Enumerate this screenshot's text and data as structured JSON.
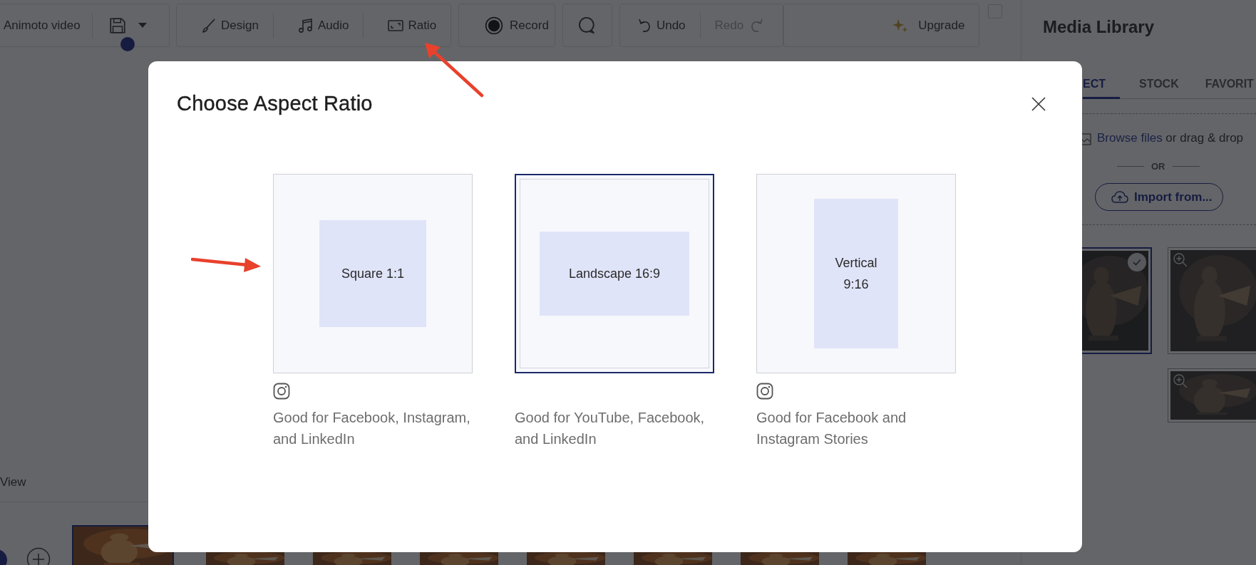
{
  "toolbar": {
    "project_name": "Animoto video",
    "tool_groups": [
      {
        "items": [
          {
            "kind": "brush",
            "label": "Design",
            "disabled": false
          },
          {
            "kind": "music",
            "label": "Audio",
            "disabled": false
          },
          {
            "kind": "ratio",
            "label": "Ratio",
            "disabled": false
          }
        ]
      },
      {
        "items": [
          {
            "kind": "record",
            "label": "Record",
            "disabled": false
          }
        ]
      },
      {
        "items": [
          {
            "kind": "search",
            "disabled": false
          }
        ]
      },
      {
        "items": [
          {
            "kind": "undo",
            "label": "Undo",
            "disabled": false
          },
          {
            "kind": "redo",
            "label": "Redo",
            "disabled": true
          }
        ]
      }
    ],
    "upgrade_button": "Upgrade",
    "checkbox": {
      "checked": false
    }
  },
  "media_library": {
    "title": "Media Library",
    "tabs": [
      {
        "label": "ECT",
        "selected": true
      },
      {
        "label": "STOCK",
        "selected": false
      },
      {
        "label": "FAVORIT",
        "selected": false
      }
    ],
    "browse_link": "Browse files",
    "drop_text": "or drag & drop",
    "or_label": "OR",
    "import_button": "Import from...",
    "thumbnails": [
      {
        "selected": true
      },
      {
        "selected": false
      },
      {
        "selected": false
      }
    ]
  },
  "timeline": {
    "view_label": "View"
  },
  "modal": {
    "title": "Choose Aspect Ratio",
    "options": [
      {
        "kind": "square",
        "label": "Square 1:1",
        "selected": false,
        "instagram": true,
        "description": "Good for Facebook, Instagram, and LinkedIn"
      },
      {
        "kind": "landscape",
        "label": "Landscape 16:9",
        "selected": true,
        "instagram": false,
        "description": "Good for YouTube, Facebook, and LinkedIn"
      },
      {
        "kind": "vertical",
        "label": "Vertical 9:16",
        "selected": false,
        "instagram": true,
        "description": "Good for Facebook and Instagram Stories"
      }
    ]
  }
}
